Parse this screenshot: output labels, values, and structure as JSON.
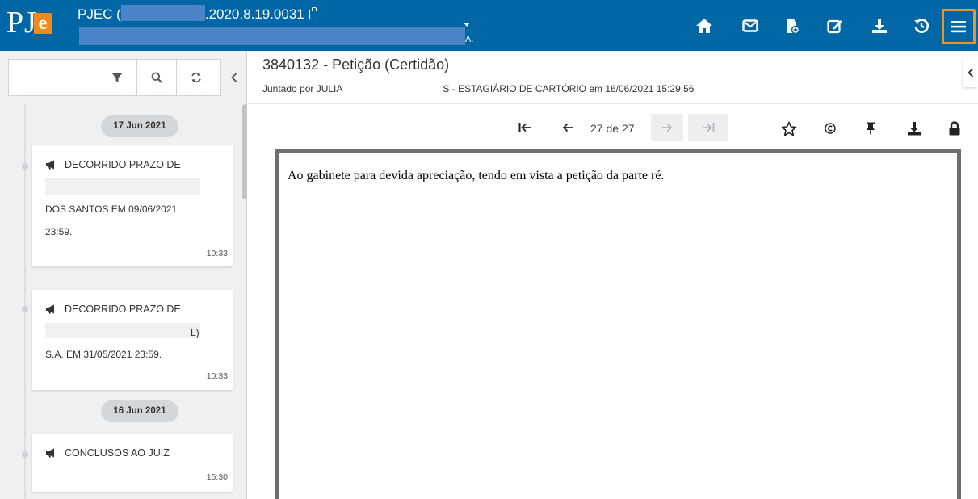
{
  "header": {
    "logo": {
      "p": "P",
      "j": "J",
      "e": "e"
    },
    "process_prefix": "PJEC (",
    "process_suffix": ".2020.8.19.0031",
    "process_sub_tail": "A.",
    "icons": [
      "home-icon",
      "envelope-icon",
      "file-add-icon",
      "edit-icon",
      "download-icon",
      "history-icon",
      "menu-icon"
    ],
    "menu_highlight_color": "#f0932b",
    "bar_color": "#0067a6"
  },
  "sidebar": {
    "search": {
      "value": "",
      "placeholder": ""
    },
    "buttons": [
      "filter-icon",
      "search-icon",
      "refresh-icon",
      "chevron-left-icon"
    ],
    "timeline": [
      {
        "date": "17 Jun 2021"
      },
      {
        "title": "DECORRIDO PRAZO DE",
        "lines": [
          "DOS SANTOS EM 09/06/2021",
          "23:59."
        ],
        "time": "10:33"
      },
      {
        "title": "DECORRIDO PRAZO DE",
        "lines": [
          "L)",
          "S.A. EM 31/05/2021 23:59."
        ],
        "time": "10:33"
      },
      {
        "date": "16 Jun 2021"
      },
      {
        "title": "CONCLUSOS AO JUIZ",
        "lines": [],
        "time": "15:30"
      }
    ]
  },
  "document": {
    "title": "3840132 - Petição (Certidão)",
    "joined_prefix": "Juntado por JULIA",
    "joined_suffix": "S - ESTAGIÁRIO DE CARTÓRIO em 16/06/2021 15:29:56",
    "pager": "27 de 27",
    "body_text": "Ao gabinete para devida apreciação, tendo em vista a petição da parte ré."
  }
}
